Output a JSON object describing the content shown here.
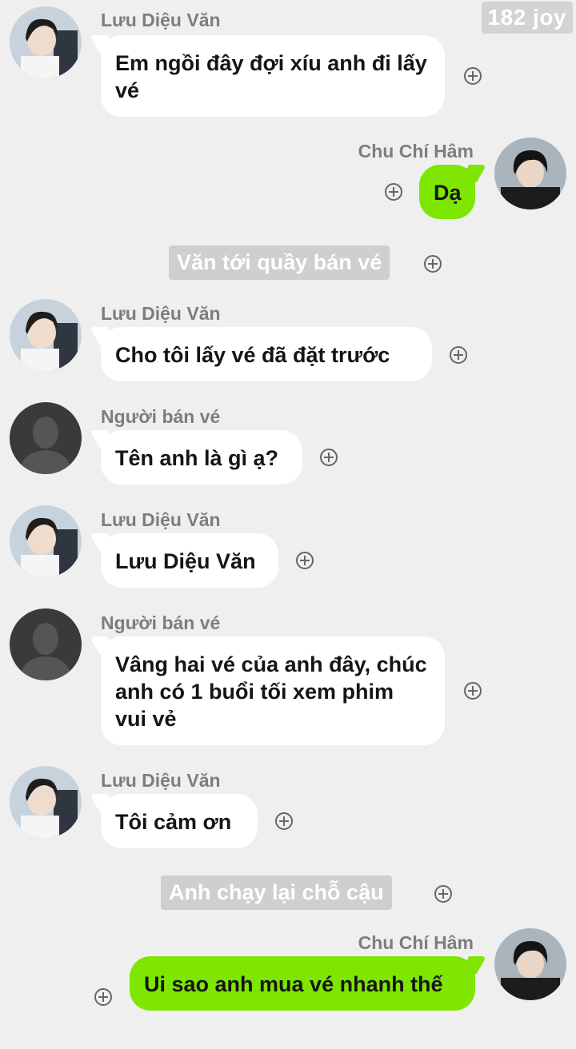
{
  "badge": "182 joy",
  "messages": [
    {
      "sender": "Lưu Diệu Văn",
      "text": "Em ngồi đây đợi xíu anh đi lấy vé"
    },
    {
      "sender": "Chu Chí Hâm",
      "text": "Dạ"
    },
    {
      "narration": "Văn tới quầy bán vé"
    },
    {
      "sender": "Lưu Diệu Văn",
      "text": "Cho tôi lấy vé đã đặt trước"
    },
    {
      "sender": "Người bán vé",
      "text": "Tên anh là gì ạ?"
    },
    {
      "sender": "Lưu Diệu Văn",
      "text": "Lưu Diệu Văn"
    },
    {
      "sender": "Người bán vé",
      "text": "Vâng hai vé của anh đây, chúc anh có 1 buổi tối xem phim vui vẻ"
    },
    {
      "sender": "Lưu Diệu Văn",
      "text": "Tôi cảm ơn"
    },
    {
      "narration": "Anh chạy lại chỗ cậu"
    },
    {
      "sender": "Chu Chí Hâm",
      "text": "Ui sao anh mua vé nhanh thế"
    }
  ],
  "colors": {
    "background": "#efefef",
    "incoming_bubble": "#ffffff",
    "outgoing_bubble": "#7ee600",
    "sender_name": "#7d7d7d",
    "narration_bg": "#cfcfcf"
  },
  "icons": [
    "avatar-photo",
    "avatar-placeholder",
    "add-reaction-icon"
  ]
}
